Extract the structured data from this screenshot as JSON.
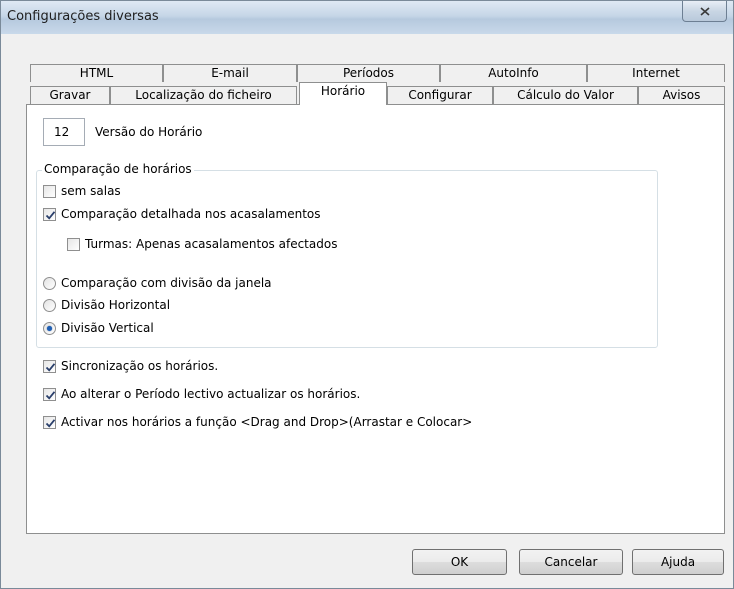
{
  "window": {
    "title": "Configurações diversas"
  },
  "tabs_row1": [
    "HTML",
    "E-mail",
    "Períodos",
    "AutoInfo",
    "Internet"
  ],
  "tabs_row2": [
    "Gravar",
    "Localização do ficheiro",
    "Horário",
    "Configurar",
    "Cálculo do Valor",
    "Avisos"
  ],
  "active_tab": "Horário",
  "version": {
    "value": "12",
    "label": "Versão do Horário"
  },
  "comparison_group": {
    "title": "Comparação de horários",
    "sem_salas": {
      "label": "sem salas",
      "checked": false
    },
    "detalhada": {
      "label": "Comparação detalhada nos acasalamentos",
      "checked": true
    },
    "turmas": {
      "label": "Turmas: Apenas acasalamentos afectados",
      "checked": false
    },
    "radio_janela": {
      "label": "Comparação com divisão da janela",
      "selected": false
    },
    "radio_horizontal": {
      "label": "Divisão Horizontal",
      "selected": false
    },
    "radio_vertical": {
      "label": "Divisão Vertical",
      "selected": true
    }
  },
  "options": {
    "sincronizacao": {
      "label": "Sincronização os horários.",
      "checked": true
    },
    "periodo": {
      "label": "Ao alterar o Período lectivo actualizar os horários.",
      "checked": true
    },
    "dragdrop": {
      "label": "Activar nos horários a função <Drag and Drop>(Arrastar e Colocar>",
      "checked": true
    }
  },
  "buttons": {
    "ok": "OK",
    "cancel": "Cancelar",
    "help": "Ajuda"
  }
}
